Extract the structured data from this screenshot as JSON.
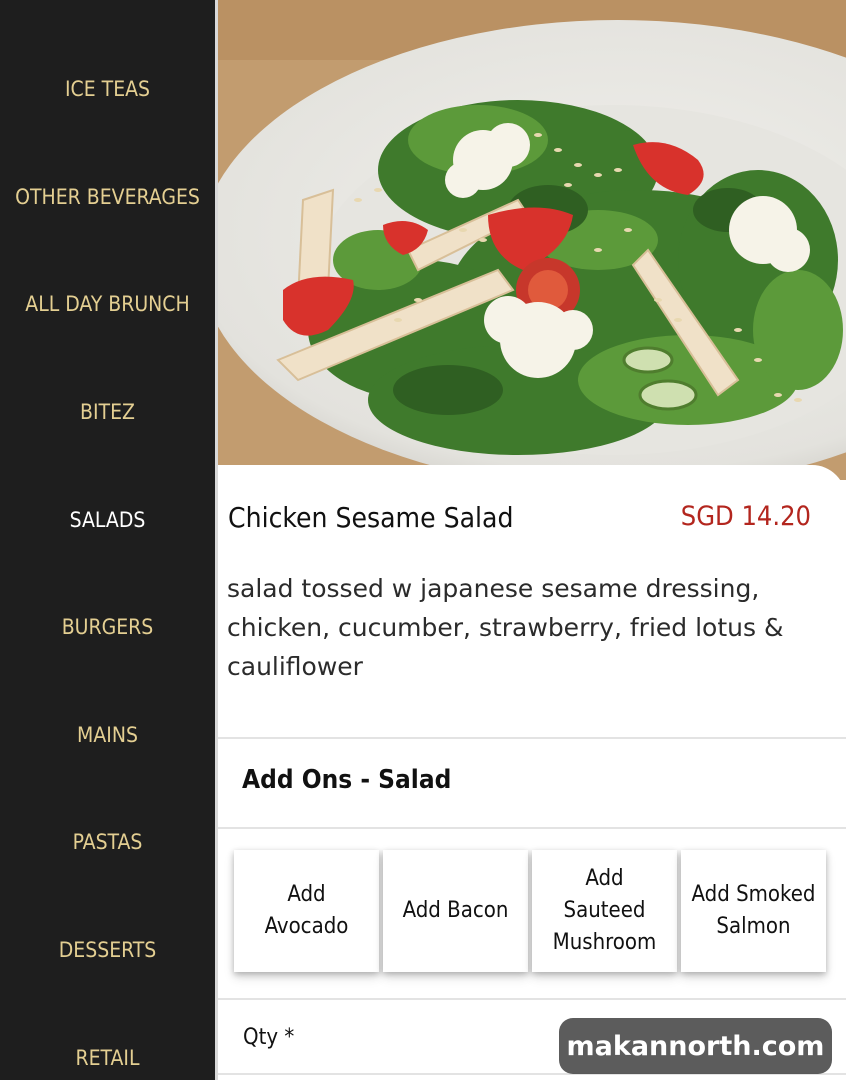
{
  "sidebar": {
    "items": [
      {
        "label": "ICE TEAS",
        "active": false
      },
      {
        "label": "OTHER BEVERAGES",
        "active": false
      },
      {
        "label": "ALL DAY BRUNCH",
        "active": false
      },
      {
        "label": "BITEZ",
        "active": false
      },
      {
        "label": "SALADS",
        "active": true
      },
      {
        "label": "BURGERS",
        "active": false
      },
      {
        "label": "MAINS",
        "active": false
      },
      {
        "label": "PASTAS",
        "active": false
      },
      {
        "label": "DESSERTS",
        "active": false
      },
      {
        "label": "RETAIL",
        "active": false
      }
    ]
  },
  "product": {
    "name": "Chicken Sesame Salad",
    "price": "SGD 14.20",
    "description": "salad tossed w japanese sesame dressing, chicken, cucumber, strawberry, fried lotus & cauliflower"
  },
  "addons": {
    "title": "Add Ons - Salad",
    "options": [
      {
        "label": "Add\nAvocado"
      },
      {
        "label": "Add Bacon"
      },
      {
        "label": "Add\nSauteed\nMushroom"
      },
      {
        "label": "Add Smoked\nSalmon"
      }
    ]
  },
  "qty": {
    "label": "Qty *"
  },
  "watermark": "makannorth.com",
  "colors": {
    "sidebar_bg": "#1e1e1e",
    "sidebar_text": "#e4cf92",
    "sidebar_active": "#ffffff",
    "price": "#b3261e"
  },
  "icons": {
    "hero_image": "salad-photo"
  }
}
